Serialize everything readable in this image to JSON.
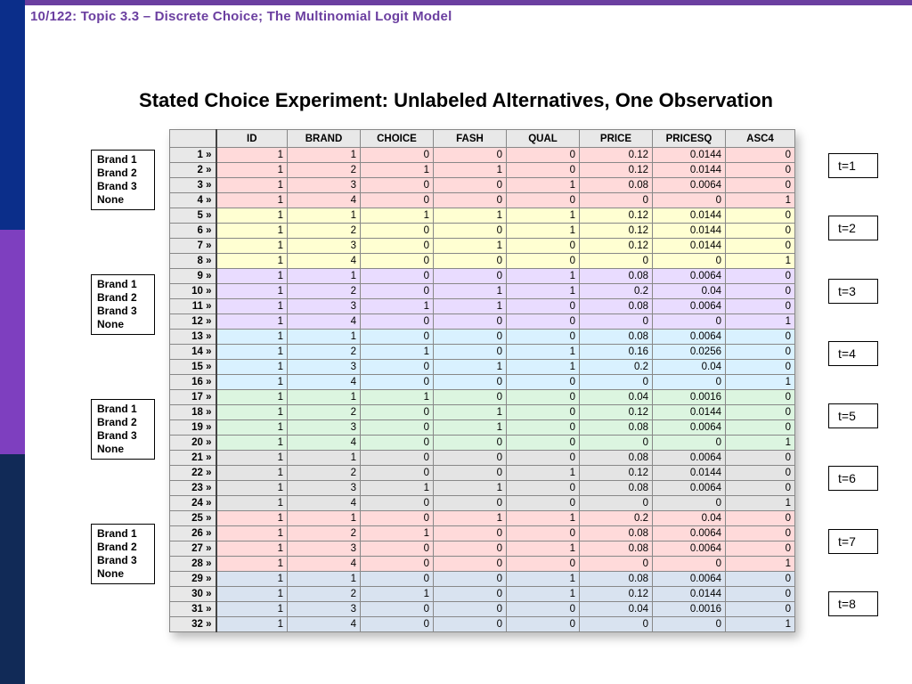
{
  "header": "10/122: Topic 3.3 – Discrete Choice; The Multinomial Logit Model",
  "title": "Stated Choice Experiment: Unlabeled Alternatives, One Observation",
  "brand_labels": [
    "Brand 1",
    "Brand 2",
    "Brand 3",
    "None"
  ],
  "t_labels": [
    "t=1",
    "t=2",
    "t=3",
    "t=4",
    "t=5",
    "t=6",
    "t=7",
    "t=8"
  ],
  "columns": [
    "ID",
    "BRAND",
    "CHOICE",
    "FASH",
    "QUAL",
    "PRICE",
    "PRICESQ",
    "ASC4"
  ],
  "group_colors": [
    "#ffdada",
    "#ffffd2",
    "#e9dcff",
    "#d9f1ff",
    "#dcf5e0",
    "#e4e4e4",
    "#ffdada",
    "#d9e3f0"
  ],
  "rows": [
    {
      "n": 1,
      "g": 0,
      "id": 1,
      "brand": 1,
      "choice": 0,
      "fash": 0,
      "qual": 0,
      "price": "0.12",
      "pricesq": "0.0144",
      "asc4": 0
    },
    {
      "n": 2,
      "g": 0,
      "id": 1,
      "brand": 2,
      "choice": 1,
      "fash": 1,
      "qual": 0,
      "price": "0.12",
      "pricesq": "0.0144",
      "asc4": 0
    },
    {
      "n": 3,
      "g": 0,
      "id": 1,
      "brand": 3,
      "choice": 0,
      "fash": 0,
      "qual": 1,
      "price": "0.08",
      "pricesq": "0.0064",
      "asc4": 0
    },
    {
      "n": 4,
      "g": 0,
      "id": 1,
      "brand": 4,
      "choice": 0,
      "fash": 0,
      "qual": 0,
      "price": "0",
      "pricesq": "0",
      "asc4": 1
    },
    {
      "n": 5,
      "g": 1,
      "id": 1,
      "brand": 1,
      "choice": 1,
      "fash": 1,
      "qual": 1,
      "price": "0.12",
      "pricesq": "0.0144",
      "asc4": 0
    },
    {
      "n": 6,
      "g": 1,
      "id": 1,
      "brand": 2,
      "choice": 0,
      "fash": 0,
      "qual": 1,
      "price": "0.12",
      "pricesq": "0.0144",
      "asc4": 0
    },
    {
      "n": 7,
      "g": 1,
      "id": 1,
      "brand": 3,
      "choice": 0,
      "fash": 1,
      "qual": 0,
      "price": "0.12",
      "pricesq": "0.0144",
      "asc4": 0
    },
    {
      "n": 8,
      "g": 1,
      "id": 1,
      "brand": 4,
      "choice": 0,
      "fash": 0,
      "qual": 0,
      "price": "0",
      "pricesq": "0",
      "asc4": 1
    },
    {
      "n": 9,
      "g": 2,
      "id": 1,
      "brand": 1,
      "choice": 0,
      "fash": 0,
      "qual": 1,
      "price": "0.08",
      "pricesq": "0.0064",
      "asc4": 0
    },
    {
      "n": 10,
      "g": 2,
      "id": 1,
      "brand": 2,
      "choice": 0,
      "fash": 1,
      "qual": 1,
      "price": "0.2",
      "pricesq": "0.04",
      "asc4": 0
    },
    {
      "n": 11,
      "g": 2,
      "id": 1,
      "brand": 3,
      "choice": 1,
      "fash": 1,
      "qual": 0,
      "price": "0.08",
      "pricesq": "0.0064",
      "asc4": 0
    },
    {
      "n": 12,
      "g": 2,
      "id": 1,
      "brand": 4,
      "choice": 0,
      "fash": 0,
      "qual": 0,
      "price": "0",
      "pricesq": "0",
      "asc4": 1
    },
    {
      "n": 13,
      "g": 3,
      "id": 1,
      "brand": 1,
      "choice": 0,
      "fash": 0,
      "qual": 0,
      "price": "0.08",
      "pricesq": "0.0064",
      "asc4": 0
    },
    {
      "n": 14,
      "g": 3,
      "id": 1,
      "brand": 2,
      "choice": 1,
      "fash": 0,
      "qual": 1,
      "price": "0.16",
      "pricesq": "0.0256",
      "asc4": 0
    },
    {
      "n": 15,
      "g": 3,
      "id": 1,
      "brand": 3,
      "choice": 0,
      "fash": 1,
      "qual": 1,
      "price": "0.2",
      "pricesq": "0.04",
      "asc4": 0
    },
    {
      "n": 16,
      "g": 3,
      "id": 1,
      "brand": 4,
      "choice": 0,
      "fash": 0,
      "qual": 0,
      "price": "0",
      "pricesq": "0",
      "asc4": 1
    },
    {
      "n": 17,
      "g": 4,
      "id": 1,
      "brand": 1,
      "choice": 1,
      "fash": 0,
      "qual": 0,
      "price": "0.04",
      "pricesq": "0.0016",
      "asc4": 0
    },
    {
      "n": 18,
      "g": 4,
      "id": 1,
      "brand": 2,
      "choice": 0,
      "fash": 1,
      "qual": 0,
      "price": "0.12",
      "pricesq": "0.0144",
      "asc4": 0
    },
    {
      "n": 19,
      "g": 4,
      "id": 1,
      "brand": 3,
      "choice": 0,
      "fash": 1,
      "qual": 0,
      "price": "0.08",
      "pricesq": "0.0064",
      "asc4": 0
    },
    {
      "n": 20,
      "g": 4,
      "id": 1,
      "brand": 4,
      "choice": 0,
      "fash": 0,
      "qual": 0,
      "price": "0",
      "pricesq": "0",
      "asc4": 1
    },
    {
      "n": 21,
      "g": 5,
      "id": 1,
      "brand": 1,
      "choice": 0,
      "fash": 0,
      "qual": 0,
      "price": "0.08",
      "pricesq": "0.0064",
      "asc4": 0
    },
    {
      "n": 22,
      "g": 5,
      "id": 1,
      "brand": 2,
      "choice": 0,
      "fash": 0,
      "qual": 1,
      "price": "0.12",
      "pricesq": "0.0144",
      "asc4": 0
    },
    {
      "n": 23,
      "g": 5,
      "id": 1,
      "brand": 3,
      "choice": 1,
      "fash": 1,
      "qual": 0,
      "price": "0.08",
      "pricesq": "0.0064",
      "asc4": 0
    },
    {
      "n": 24,
      "g": 5,
      "id": 1,
      "brand": 4,
      "choice": 0,
      "fash": 0,
      "qual": 0,
      "price": "0",
      "pricesq": "0",
      "asc4": 1
    },
    {
      "n": 25,
      "g": 6,
      "id": 1,
      "brand": 1,
      "choice": 0,
      "fash": 1,
      "qual": 1,
      "price": "0.2",
      "pricesq": "0.04",
      "asc4": 0
    },
    {
      "n": 26,
      "g": 6,
      "id": 1,
      "brand": 2,
      "choice": 1,
      "fash": 0,
      "qual": 0,
      "price": "0.08",
      "pricesq": "0.0064",
      "asc4": 0
    },
    {
      "n": 27,
      "g": 6,
      "id": 1,
      "brand": 3,
      "choice": 0,
      "fash": 0,
      "qual": 1,
      "price": "0.08",
      "pricesq": "0.0064",
      "asc4": 0
    },
    {
      "n": 28,
      "g": 6,
      "id": 1,
      "brand": 4,
      "choice": 0,
      "fash": 0,
      "qual": 0,
      "price": "0",
      "pricesq": "0",
      "asc4": 1
    },
    {
      "n": 29,
      "g": 7,
      "id": 1,
      "brand": 1,
      "choice": 0,
      "fash": 0,
      "qual": 1,
      "price": "0.08",
      "pricesq": "0.0064",
      "asc4": 0
    },
    {
      "n": 30,
      "g": 7,
      "id": 1,
      "brand": 2,
      "choice": 1,
      "fash": 0,
      "qual": 1,
      "price": "0.12",
      "pricesq": "0.0144",
      "asc4": 0
    },
    {
      "n": 31,
      "g": 7,
      "id": 1,
      "brand": 3,
      "choice": 0,
      "fash": 0,
      "qual": 0,
      "price": "0.04",
      "pricesq": "0.0016",
      "asc4": 0
    },
    {
      "n": 32,
      "g": 7,
      "id": 1,
      "brand": 4,
      "choice": 0,
      "fash": 0,
      "qual": 0,
      "price": "0",
      "pricesq": "0",
      "asc4": 1
    }
  ]
}
